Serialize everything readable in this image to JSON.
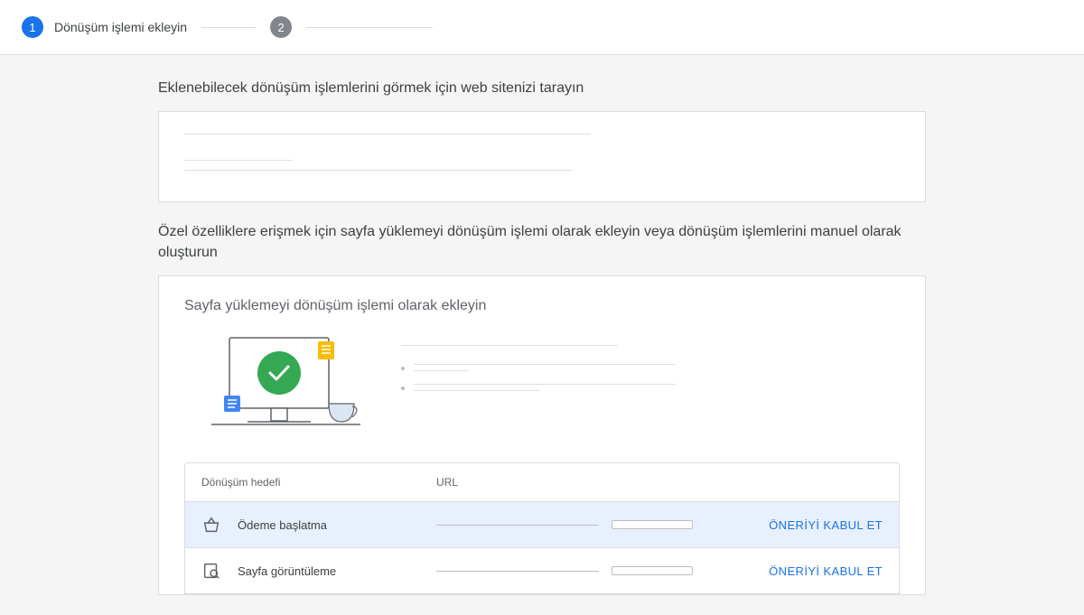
{
  "stepper": {
    "step1_number": "1",
    "step1_label": "Dönüşüm işlemi ekleyin",
    "step2_number": "2"
  },
  "section1": {
    "title": "Eklenebilecek dönüşüm işlemlerini görmek için web sitenizi tarayın"
  },
  "section2": {
    "title": "Özel özelliklere erişmek için sayfa yüklemeyi dönüşüm işlemi olarak ekleyin veya dönüşüm işlemlerini manuel olarak oluşturun"
  },
  "card2": {
    "title": "Sayfa yüklemeyi dönüşüm işlemi olarak ekleyin"
  },
  "table": {
    "header_goal": "Dönüşüm hedefi",
    "header_url": "URL",
    "rows": [
      {
        "goal": "Ödeme başlatma",
        "action": "ÖNERİYİ KABUL ET"
      },
      {
        "goal": "Sayfa görüntüleme",
        "action": "ÖNERİYİ KABUL ET"
      }
    ]
  }
}
